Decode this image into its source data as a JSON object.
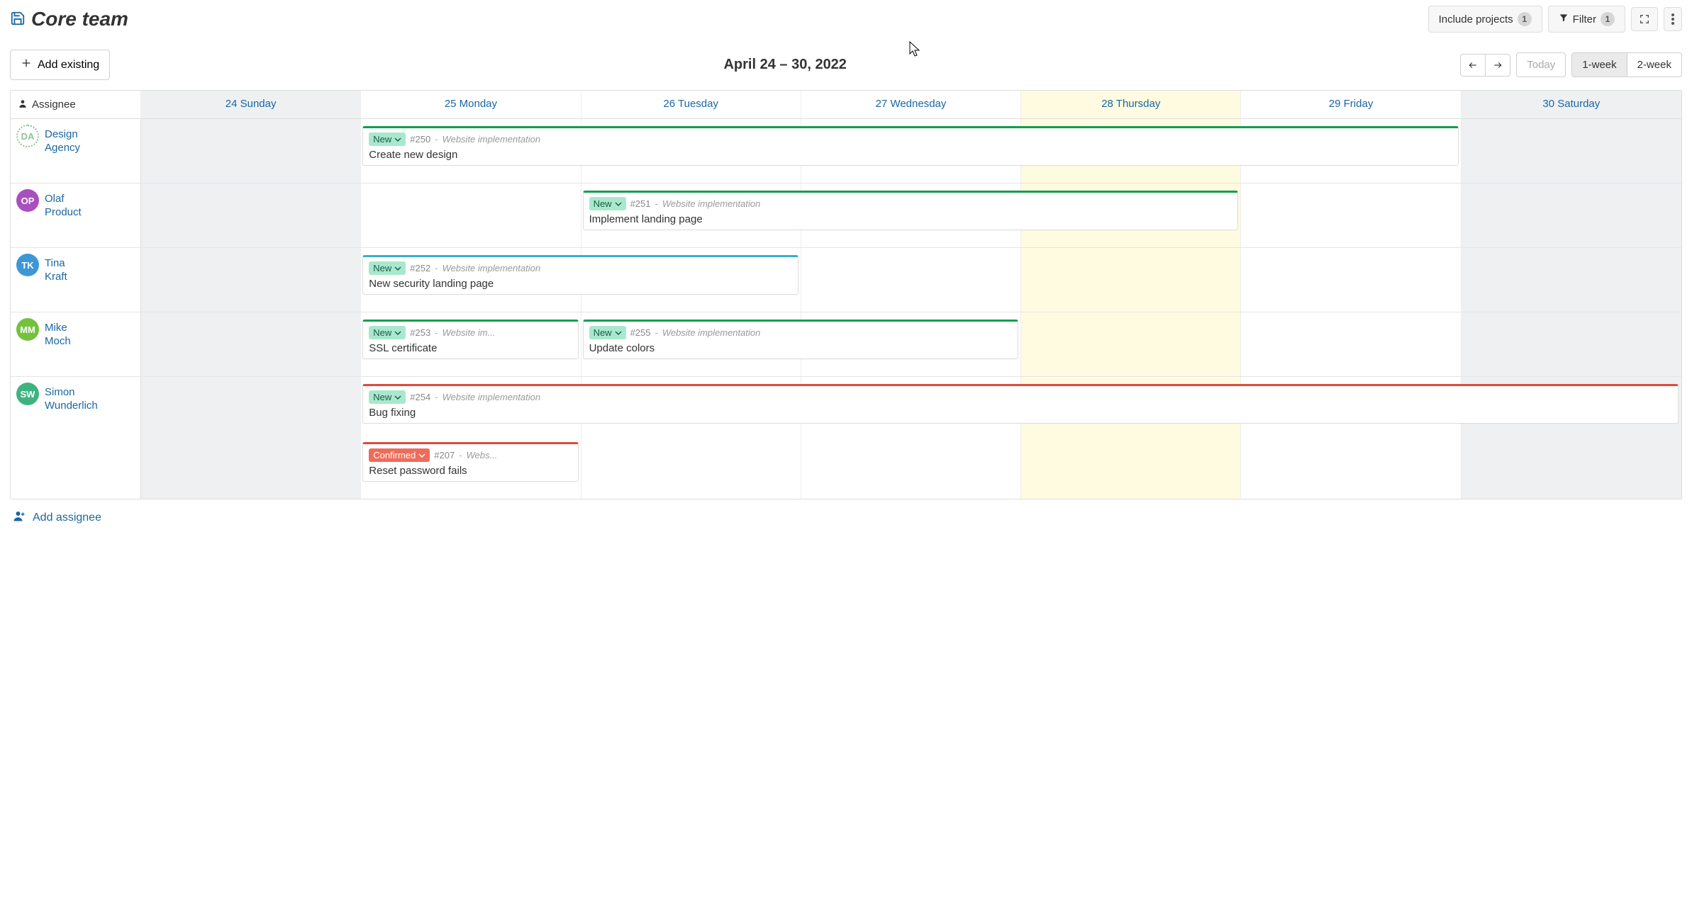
{
  "title": "Core team",
  "toolbar_top": {
    "include_projects": {
      "label": "Include projects",
      "count": "1"
    },
    "filter": {
      "label": "Filter",
      "count": "1"
    }
  },
  "add_existing": "Add existing",
  "date_range": "April 24 – 30, 2022",
  "nav": {
    "today": "Today",
    "one_week": "1-week",
    "two_week": "2-week"
  },
  "columns": {
    "label": "Assignee",
    "days": [
      "24 Sunday",
      "25 Monday",
      "26 Tuesday",
      "27 Wednesday",
      "28 Thursday",
      "29 Friday",
      "30 Saturday"
    ],
    "weekend": [
      0,
      6
    ],
    "today_index": 4
  },
  "assignees": [
    {
      "initials": "DA",
      "name": "Design Agency",
      "avatar_style": "dashed",
      "avatar_color": "#8fc49a"
    },
    {
      "initials": "OP",
      "name": "Olaf Product",
      "avatar_color": "#a94fbf"
    },
    {
      "initials": "TK",
      "name": "Tina Kraft",
      "avatar_color": "#3d97d6"
    },
    {
      "initials": "MM",
      "name": "Mike Moch",
      "avatar_color": "#74c23c"
    },
    {
      "initials": "SW",
      "name": "Simon Wunderlich",
      "avatar_color": "#3fb37f"
    }
  ],
  "tasks": {
    "da": [
      {
        "lane": 0,
        "start": 1,
        "span": 5,
        "status": "New",
        "status_type": "new",
        "id": "#250",
        "project": "Website implementation",
        "title": "Create new design",
        "color": "#0f9f4f"
      }
    ],
    "op": [
      {
        "lane": 0,
        "start": 2,
        "span": 3,
        "status": "New",
        "status_type": "new",
        "id": "#251",
        "project": "Website implementation",
        "title": "Implement landing page",
        "color": "#0f9f4f"
      }
    ],
    "tk": [
      {
        "lane": 0,
        "start": 1,
        "span": 2,
        "status": "New",
        "status_type": "new",
        "id": "#252",
        "project": "Website implementation",
        "title": "New security landing page",
        "color": "#36afd0"
      }
    ],
    "mm": [
      {
        "lane": 0,
        "start": 1,
        "span": 1,
        "status": "New",
        "status_type": "new",
        "id": "#253",
        "project": "Website im...",
        "title": "SSL certificate",
        "color": "#0f9f4f"
      },
      {
        "lane": 0,
        "start": 2,
        "span": 2,
        "status": "New",
        "status_type": "new",
        "id": "#255",
        "project": "Website implementation",
        "title": "Update colors",
        "color": "#0f9f4f"
      }
    ],
    "sw": [
      {
        "lane": 0,
        "start": 1,
        "span": 6,
        "status": "New",
        "status_type": "new",
        "id": "#254",
        "project": "Website implementation",
        "title": "Bug fixing",
        "color": "#e04a3a"
      },
      {
        "lane": 1,
        "start": 1,
        "span": 1,
        "status": "Confirmed",
        "status_type": "confirmed",
        "id": "#207",
        "project": "Webs...",
        "title": "Reset password fails",
        "color": "#e04a3a"
      }
    ]
  },
  "add_assignee": "Add assignee"
}
